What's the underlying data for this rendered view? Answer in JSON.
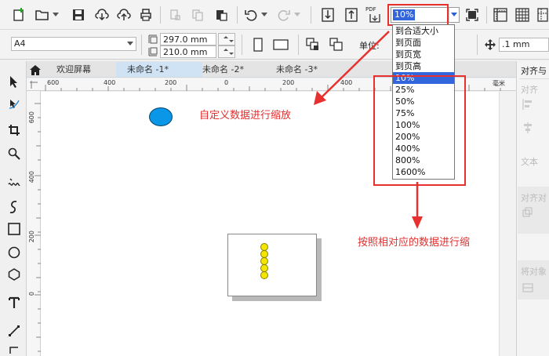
{
  "toolbar": {
    "zoom_value": "10%",
    "pdf_label": "PDF"
  },
  "property_bar": {
    "page_size": "A4",
    "width": "297.0 mm",
    "height": "210.0 mm",
    "units_label": "单位:",
    "nudge_value": ".1 mm"
  },
  "tabs": [
    {
      "label": "欢迎屏幕"
    },
    {
      "label": "未命名 -1*"
    },
    {
      "label": "未命名 -2*"
    },
    {
      "label": "未命名 -3*"
    }
  ],
  "zoom_dropdown": {
    "options": [
      "到合适大小",
      "到页面",
      "到页宽",
      "到页高",
      "10%",
      "25%",
      "50%",
      "75%",
      "100%",
      "200%",
      "400%",
      "800%",
      "1600%"
    ],
    "selected": "10%"
  },
  "ruler": {
    "horizontal": [
      "600",
      "400",
      "200",
      "0",
      "200",
      "400"
    ],
    "vertical": [
      "600",
      "400",
      "200",
      "0"
    ],
    "unit": "毫米"
  },
  "docker": {
    "title": "对齐与",
    "labels": [
      "对齐",
      "文本",
      "对齐对",
      "将对象"
    ]
  },
  "annotations": {
    "top": "自定义数据进行缩放",
    "bottom": "按照相对应的数据进行缩"
  },
  "colors": {
    "ellipse_fill": "#0a97e8",
    "circle_fill": "#f5e600",
    "annotation_red": "#e8302f",
    "selection_blue": "#3366dd"
  }
}
